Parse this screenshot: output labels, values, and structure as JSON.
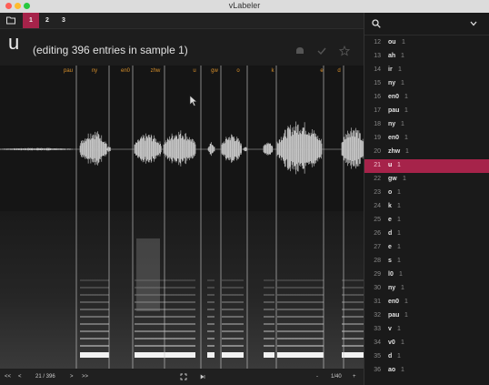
{
  "window": {
    "title": "vLabeler"
  },
  "tabs": [
    {
      "label": "1",
      "active": true
    },
    {
      "label": "2",
      "active": false
    },
    {
      "label": "3",
      "active": false
    }
  ],
  "header": {
    "entry_name": "u",
    "subtitle": "(editing 396 entries in sample 1)"
  },
  "canvas": {
    "labels": [
      "pau",
      "ny",
      "en0",
      "zhw",
      "u",
      "gw",
      "o",
      "k",
      "e",
      "d"
    ]
  },
  "bottom": {
    "first": "<<",
    "prev": "<",
    "position": "21 / 396",
    "next": ">",
    "last": ">>",
    "zoom_out": "-",
    "zoom_level": "1/40",
    "zoom_in": "+"
  },
  "sidebar": {
    "entries": [
      {
        "num": "12",
        "name": "ou",
        "count": "1"
      },
      {
        "num": "13",
        "name": "ah",
        "count": "1"
      },
      {
        "num": "14",
        "name": "ir",
        "count": "1"
      },
      {
        "num": "15",
        "name": "ny",
        "count": "1"
      },
      {
        "num": "16",
        "name": "en0",
        "count": "1"
      },
      {
        "num": "17",
        "name": "pau",
        "count": "1"
      },
      {
        "num": "18",
        "name": "ny",
        "count": "1"
      },
      {
        "num": "19",
        "name": "en0",
        "count": "1"
      },
      {
        "num": "20",
        "name": "zhw",
        "count": "1"
      },
      {
        "num": "21",
        "name": "u",
        "count": "1",
        "selected": true
      },
      {
        "num": "22",
        "name": "gw",
        "count": "1"
      },
      {
        "num": "23",
        "name": "o",
        "count": "1"
      },
      {
        "num": "24",
        "name": "k",
        "count": "1"
      },
      {
        "num": "25",
        "name": "e",
        "count": "1"
      },
      {
        "num": "26",
        "name": "d",
        "count": "1"
      },
      {
        "num": "27",
        "name": "e",
        "count": "1"
      },
      {
        "num": "28",
        "name": "s",
        "count": "1"
      },
      {
        "num": "29",
        "name": "l0",
        "count": "1"
      },
      {
        "num": "30",
        "name": "ny",
        "count": "1"
      },
      {
        "num": "31",
        "name": "en0",
        "count": "1"
      },
      {
        "num": "32",
        "name": "pau",
        "count": "1"
      },
      {
        "num": "33",
        "name": "v",
        "count": "1"
      },
      {
        "num": "34",
        "name": "v0",
        "count": "1"
      },
      {
        "num": "35",
        "name": "d",
        "count": "1"
      },
      {
        "num": "36",
        "name": "ao",
        "count": "1"
      }
    ]
  },
  "colors": {
    "accent": "#a6234a",
    "label": "#d9902a",
    "marker": "#c8c8c8"
  },
  "icons": [
    "folder-icon",
    "search-icon",
    "chevron-down-icon",
    "discard-icon",
    "check-icon",
    "star-icon",
    "fit-icon",
    "cursor-icon"
  ]
}
